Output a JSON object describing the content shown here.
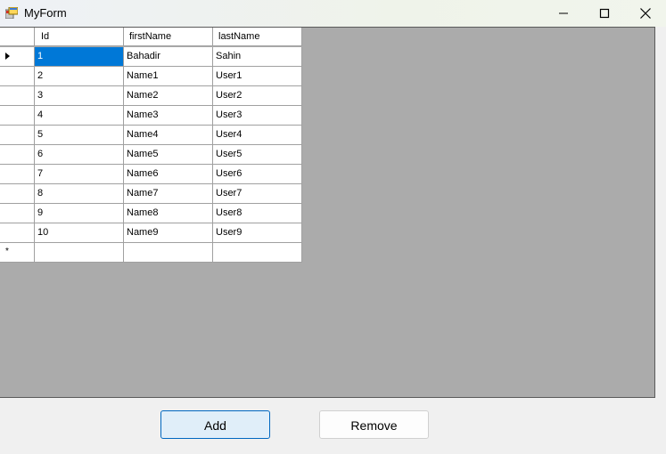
{
  "window": {
    "title": "MyForm"
  },
  "grid": {
    "columns": [
      "Id",
      "firstName",
      "lastName"
    ],
    "rows": [
      [
        "1",
        "Bahadir",
        "Sahin"
      ],
      [
        "2",
        "Name1",
        "User1"
      ],
      [
        "3",
        "Name2",
        "User2"
      ],
      [
        "4",
        "Name3",
        "User3"
      ],
      [
        "5",
        "Name4",
        "User4"
      ],
      [
        "6",
        "Name5",
        "User5"
      ],
      [
        "7",
        "Name6",
        "User6"
      ],
      [
        "8",
        "Name7",
        "User7"
      ],
      [
        "9",
        "Name8",
        "User8"
      ],
      [
        "10",
        "Name9",
        "User9"
      ]
    ],
    "selected_row": 0,
    "new_row_marker": "*"
  },
  "buttons": {
    "add_label": "Add",
    "remove_label": "Remove"
  },
  "colors": {
    "selection": "#0078d7",
    "grid_background": "#ababab"
  }
}
